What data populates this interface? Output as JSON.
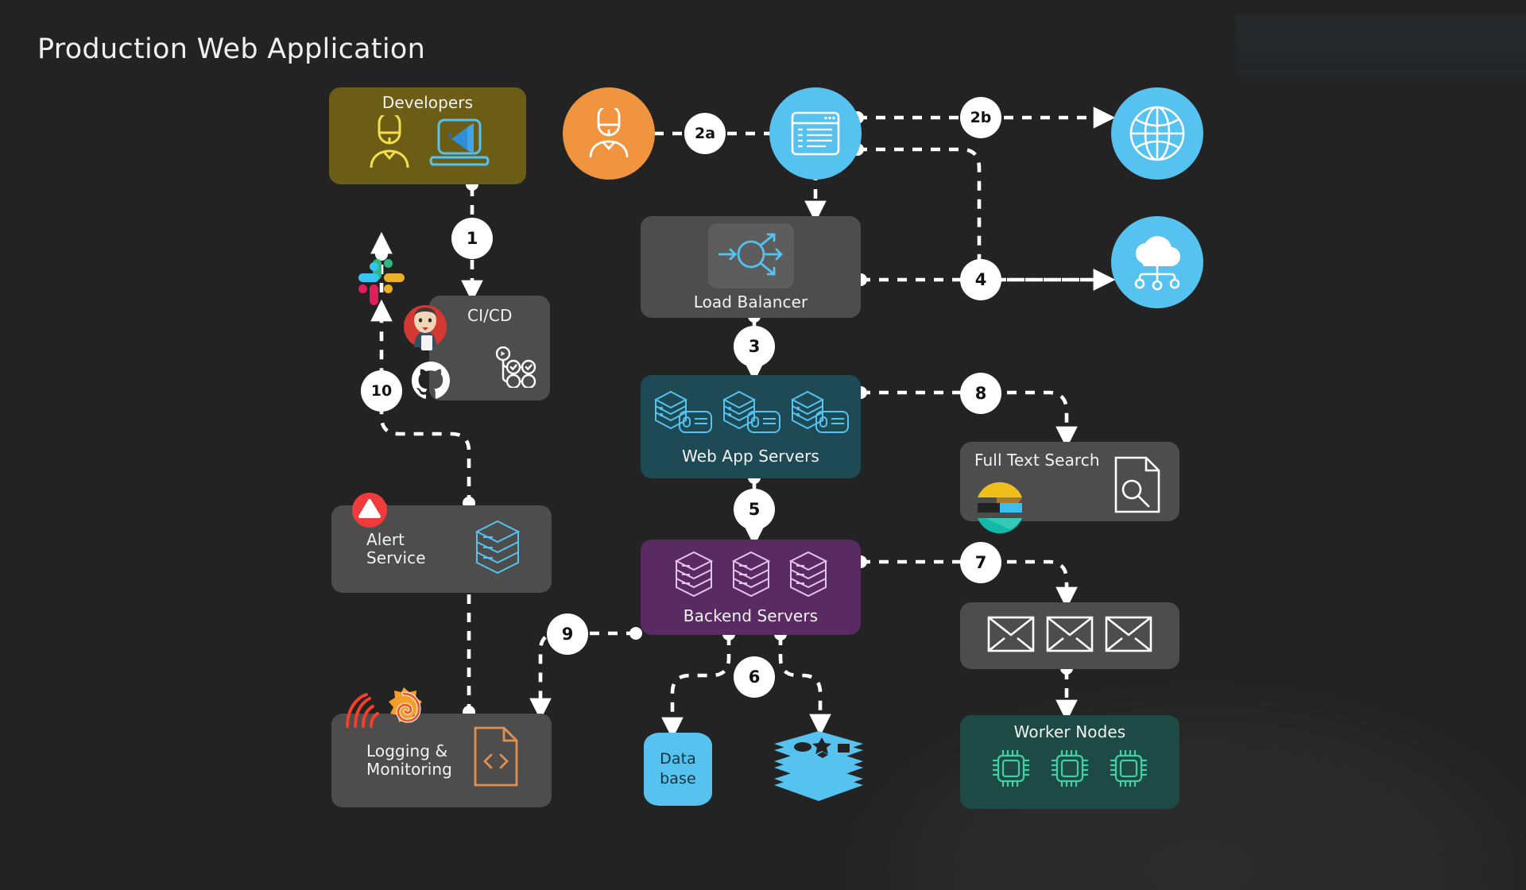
{
  "page": {
    "title": "Production Web Application",
    "background_color": "#232323"
  },
  "nodes": {
    "developers": {
      "label": "Developers",
      "color": "#6b5c16",
      "icons": [
        "developer-person-icon",
        "vscode-laptop-icon"
      ]
    },
    "cicd": {
      "label": "CI/CD",
      "color": "#4d4d4d",
      "icons": [
        "jenkins-icon",
        "github-icon",
        "pipeline-icon"
      ]
    },
    "alert": {
      "label": "Alert\nService",
      "color": "#4d4d4d",
      "icons": [
        "alert-triangle-icon",
        "server-stack-icon"
      ]
    },
    "logging": {
      "label": "Logging &\nMonitoring",
      "color": "#4d4d4d",
      "icons": [
        "grafana-icon",
        "loki-icon",
        "code-file-icon"
      ]
    },
    "user": {
      "label": "",
      "color": "#f09440",
      "icons": [
        "user-person-icon"
      ]
    },
    "browser": {
      "label": "",
      "color": "#56c2ef",
      "icons": [
        "browser-window-icon"
      ]
    },
    "globe": {
      "label": "",
      "color": "#56c2ef",
      "icons": [
        "globe-icon"
      ]
    },
    "cloud": {
      "label": "",
      "color": "#56c2ef",
      "icons": [
        "cloud-network-icon"
      ]
    },
    "loadbalancer": {
      "label": "Load Balancer",
      "color": "#4d4d4d",
      "icons": [
        "load-balancer-icon"
      ]
    },
    "webapp": {
      "label": "Web App Servers",
      "color": "#1e4a55",
      "icons": [
        "server-card-icon",
        "server-card-icon",
        "server-card-icon"
      ]
    },
    "backend": {
      "label": "Backend Servers",
      "color": "#5a2b62",
      "icons": [
        "server-stack-icon",
        "server-stack-icon",
        "server-stack-icon"
      ]
    },
    "fulltext": {
      "label": "Full Text Search",
      "color": "#4d4d4d",
      "icons": [
        "elasticsearch-icon",
        "document-search-icon"
      ]
    },
    "mailqueue": {
      "label": "",
      "color": "#4d4d4d",
      "icons": [
        "envelope-icon",
        "envelope-icon",
        "envelope-icon"
      ]
    },
    "worker": {
      "label": "Worker Nodes",
      "color": "#1d4a44",
      "icons": [
        "cpu-chip-icon",
        "cpu-chip-icon",
        "cpu-chip-icon"
      ]
    },
    "database": {
      "label": "Data\nbase",
      "color": "#56c2ef",
      "icons": [
        "database-cylinder-icon"
      ]
    },
    "cache": {
      "label": "",
      "color": "#56c2ef",
      "icons": [
        "redis-cache-icon"
      ]
    }
  },
  "flow_steps": [
    {
      "id": "1",
      "label": "1",
      "from": "developers",
      "to": "cicd"
    },
    {
      "id": "2a",
      "label": "2a",
      "from": "user",
      "to": "browser"
    },
    {
      "id": "2b",
      "label": "2b",
      "from": "browser",
      "to": "globe"
    },
    {
      "id": "3",
      "label": "3",
      "from": "loadbalancer",
      "to": "webapp"
    },
    {
      "id": "4",
      "label": "4",
      "from": "loadbalancer",
      "to": "cloud"
    },
    {
      "id": "5",
      "label": "5",
      "from": "webapp",
      "to": "backend"
    },
    {
      "id": "6",
      "label": "6",
      "from": "backend",
      "to": "database"
    },
    {
      "id": "7",
      "label": "7",
      "from": "backend",
      "to": "mailqueue"
    },
    {
      "id": "8",
      "label": "8",
      "from": "webapp",
      "to": "fulltext"
    },
    {
      "id": "9",
      "label": "9",
      "from": "backend",
      "to": "logging"
    },
    {
      "id": "10",
      "label": "10",
      "from": "alert",
      "to": "slack"
    }
  ],
  "colors": {
    "accent_blue": "#56c2ef",
    "accent_orange": "#f09440",
    "alert_red": "#ef3b3b",
    "webapp_teal": "#1e4a55",
    "backend_purple": "#5a2b62",
    "worker_green": "#1d4a44",
    "dev_olive": "#6b5c16",
    "edge_white": "#ffffff"
  }
}
